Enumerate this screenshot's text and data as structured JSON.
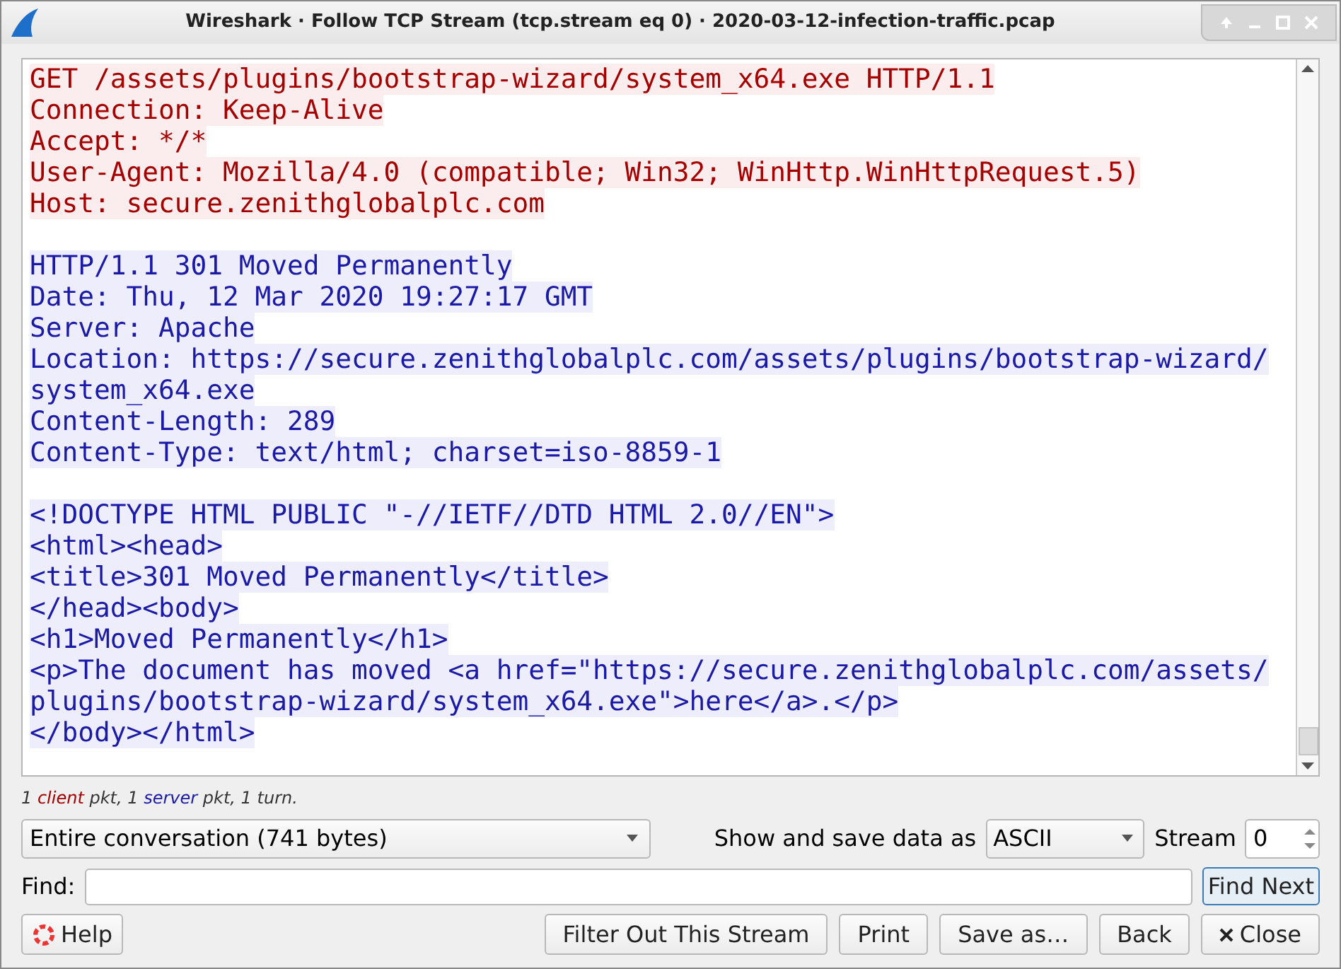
{
  "window": {
    "title": "Wireshark · Follow TCP Stream (tcp.stream eq 0) · 2020-03-12-infection-traffic.pcap"
  },
  "stream_lines": [
    {
      "kind": "client",
      "text": "GET /assets/plugins/bootstrap-wizard/system_x64.exe HTTP/1.1"
    },
    {
      "kind": "client",
      "text": "Connection: Keep-Alive"
    },
    {
      "kind": "client",
      "text": "Accept: */*"
    },
    {
      "kind": "client",
      "text": "User-Agent: Mozilla/4.0 (compatible; Win32; WinHttp.WinHttpRequest.5)"
    },
    {
      "kind": "client",
      "text": "Host: secure.zenithglobalplc.com"
    },
    {
      "kind": "blank"
    },
    {
      "kind": "server",
      "text": "HTTP/1.1 301 Moved Permanently"
    },
    {
      "kind": "server",
      "text": "Date: Thu, 12 Mar 2020 19:27:17 GMT"
    },
    {
      "kind": "server",
      "text": "Server: Apache"
    },
    {
      "kind": "server",
      "text": "Location: https://secure.zenithglobalplc.com/assets/plugins/bootstrap-wizard/"
    },
    {
      "kind": "server",
      "text": "system_x64.exe"
    },
    {
      "kind": "server",
      "text": "Content-Length: 289"
    },
    {
      "kind": "server",
      "text": "Content-Type: text/html; charset=iso-8859-1"
    },
    {
      "kind": "blank"
    },
    {
      "kind": "server",
      "text": "<!DOCTYPE HTML PUBLIC \"-//IETF//DTD HTML 2.0//EN\">"
    },
    {
      "kind": "server",
      "text": "<html><head>"
    },
    {
      "kind": "server",
      "text": "<title>301 Moved Permanently</title>"
    },
    {
      "kind": "server",
      "text": "</head><body>"
    },
    {
      "kind": "server",
      "text": "<h1>Moved Permanently</h1>"
    },
    {
      "kind": "server",
      "text": "<p>The document has moved <a href=\"https://secure.zenithglobalplc.com/assets/"
    },
    {
      "kind": "server",
      "text": "plugins/bootstrap-wizard/system_x64.exe\">here</a>.</p>"
    },
    {
      "kind": "server",
      "text": "</body></html>"
    }
  ],
  "summary": [
    {
      "kind": "plain",
      "text": "1 "
    },
    {
      "kind": "client",
      "text": "client"
    },
    {
      "kind": "plain",
      "text": " pkt, 1 "
    },
    {
      "kind": "server",
      "text": "server"
    },
    {
      "kind": "plain",
      "text": " pkt, 1 turn."
    }
  ],
  "conversation_select": {
    "value": "Entire conversation (741 bytes)"
  },
  "format_label": "Show and save data as",
  "format_select": {
    "value": "ASCII"
  },
  "stream_label": "Stream",
  "stream_spin": {
    "value": "0"
  },
  "find_label": "Find:",
  "find_next_button": "Find Next",
  "buttons": [
    {
      "kind": "help",
      "label": "Help"
    },
    {
      "kind": "plain",
      "label": "Filter Out This Stream"
    },
    {
      "kind": "plain",
      "label": "Print"
    },
    {
      "kind": "plain",
      "label": "Save as…"
    },
    {
      "kind": "plain",
      "label": "Back"
    },
    {
      "kind": "close",
      "label": "Close"
    }
  ]
}
